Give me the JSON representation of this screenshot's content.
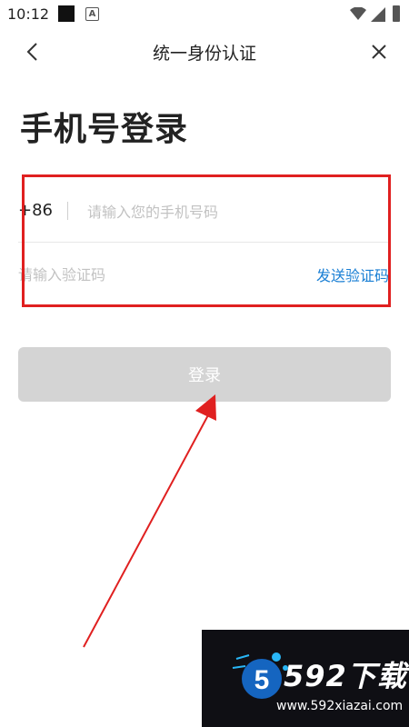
{
  "status_bar": {
    "time": "10:12",
    "notification_icon": "a-icon"
  },
  "nav": {
    "title": "统一身份认证",
    "back_icon": "chevron-left-icon",
    "close_icon": "close-icon"
  },
  "page": {
    "title": "手机号登录"
  },
  "form": {
    "country_code": "+86",
    "phone_placeholder": "请输入您的手机号码",
    "phone_value": "",
    "code_placeholder": "请输入验证码",
    "code_value": "",
    "send_code_label": "发送验证码"
  },
  "login_button": {
    "label": "登录"
  },
  "annotation": {
    "highlight_color": "#e02020",
    "arrow_color": "#e02020"
  },
  "colors": {
    "link": "#1a7fd4",
    "button_disabled": "#d4d4d4"
  },
  "watermark": {
    "brand": "592下载",
    "url": "www.592xiazai.com",
    "logo_text": "5"
  }
}
